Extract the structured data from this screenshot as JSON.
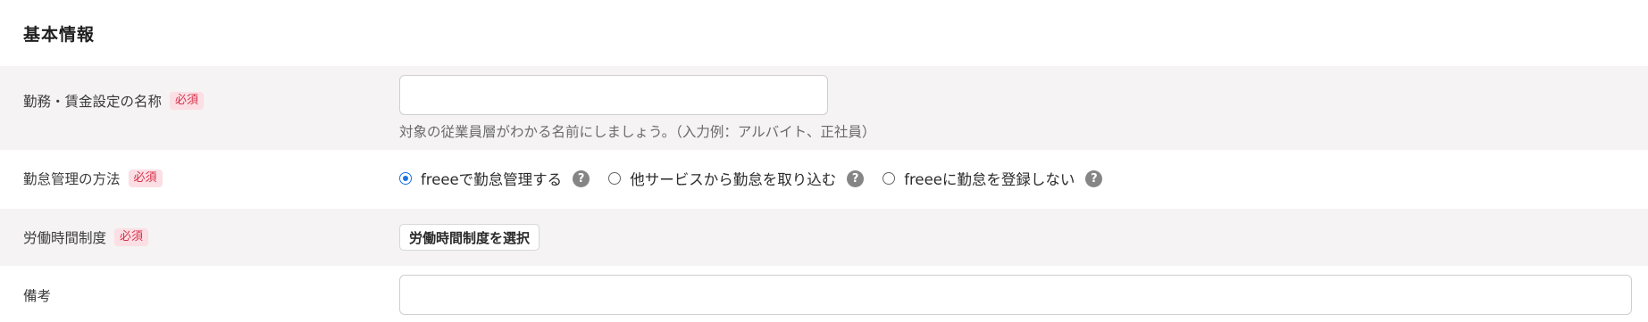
{
  "section": {
    "title": "基本情報"
  },
  "required_badge": "必須",
  "fields": {
    "name": {
      "label": "勤務・賃金設定の名称",
      "value": "",
      "hint": "対象の従業員層がわかる名前にしましょう。（入力例：アルバイト、正社員）"
    },
    "attendance": {
      "label": "勤怠管理の方法",
      "options": [
        {
          "label": "freeeで勤怠管理する",
          "checked": true
        },
        {
          "label": "他サービスから勤怠を取り込む",
          "checked": false
        },
        {
          "label": "freeeに勤怠を登録しない",
          "checked": false
        }
      ],
      "help_glyph": "?"
    },
    "work_system": {
      "label": "労働時間制度",
      "button_label": "労働時間制度を選択"
    },
    "notes": {
      "label": "備考",
      "value": ""
    }
  }
}
